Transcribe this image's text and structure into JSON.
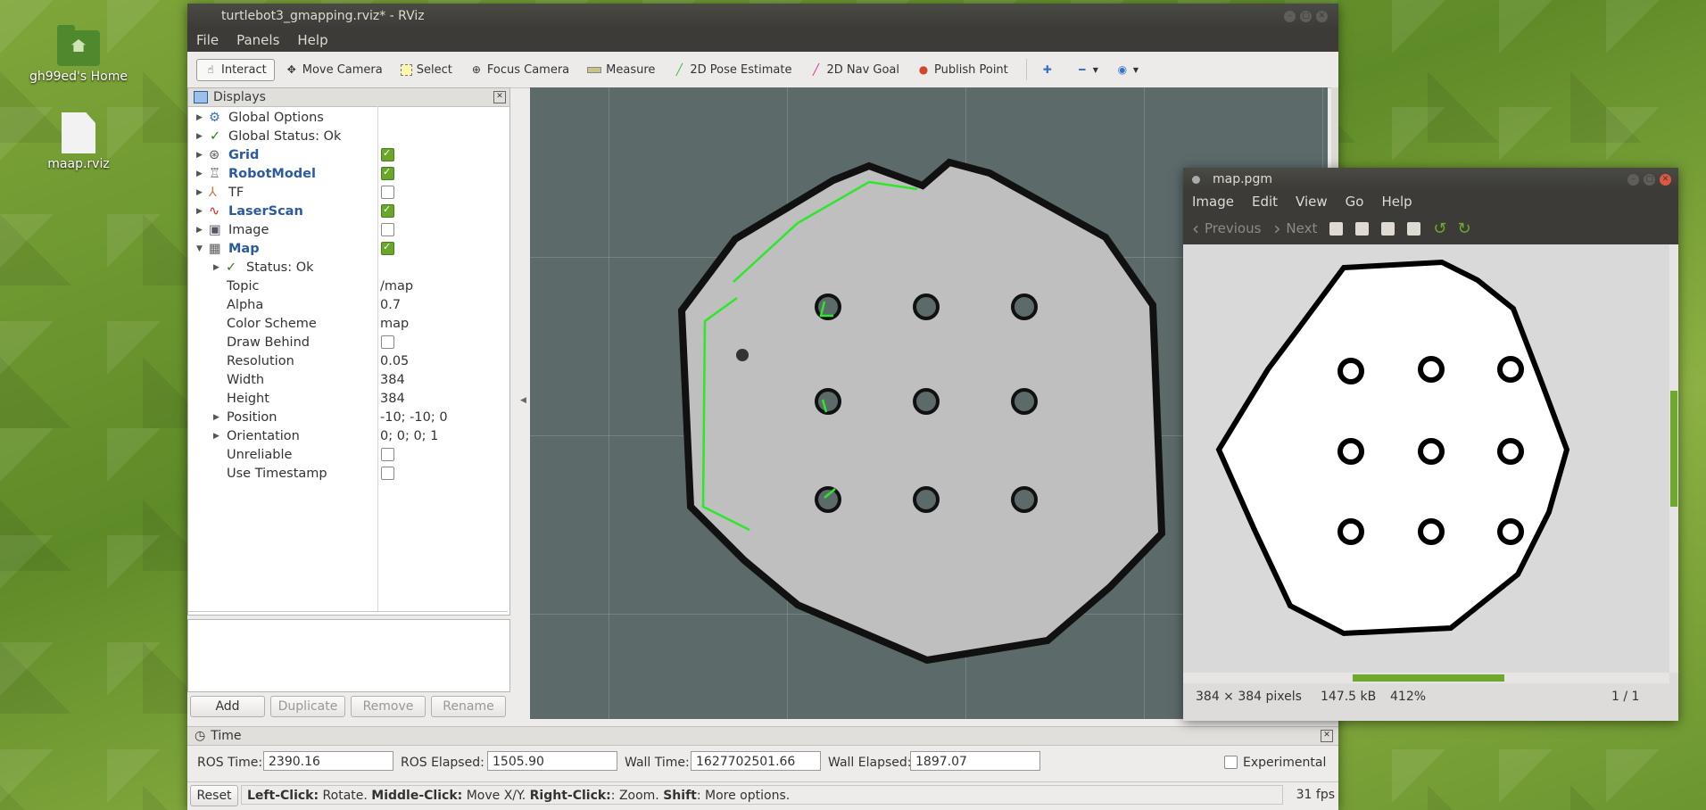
{
  "desktop": {
    "icons": [
      {
        "label": "gh99ed's Home"
      },
      {
        "label": "maap.rviz"
      }
    ]
  },
  "rviz": {
    "title": "turtlebot3_gmapping.rviz* - RViz",
    "menu": [
      "File",
      "Panels",
      "Help"
    ],
    "tools": [
      "Interact",
      "Move Camera",
      "Select",
      "Focus Camera",
      "Measure",
      "2D Pose Estimate",
      "2D Nav Goal",
      "Publish Point"
    ],
    "displays": {
      "title": "Displays",
      "items": [
        {
          "label": "Global Options"
        },
        {
          "label": "Global Status: Ok"
        },
        {
          "label": "Grid"
        },
        {
          "label": "RobotModel"
        },
        {
          "label": "TF"
        },
        {
          "label": "LaserScan"
        },
        {
          "label": "Image"
        },
        {
          "label": "Map"
        }
      ],
      "map_props": [
        {
          "label": "Status: Ok",
          "value": ""
        },
        {
          "label": "Topic",
          "value": "/map"
        },
        {
          "label": "Alpha",
          "value": "0.7"
        },
        {
          "label": "Color Scheme",
          "value": "map"
        },
        {
          "label": "Draw Behind",
          "value": ""
        },
        {
          "label": "Resolution",
          "value": "0.05"
        },
        {
          "label": "Width",
          "value": "384"
        },
        {
          "label": "Height",
          "value": "384"
        },
        {
          "label": "Position",
          "value": "-10; -10; 0"
        },
        {
          "label": "Orientation",
          "value": "0; 0; 0; 1"
        },
        {
          "label": "Unreliable",
          "value": ""
        },
        {
          "label": "Use Timestamp",
          "value": ""
        }
      ],
      "buttons": [
        "Add",
        "Duplicate",
        "Remove",
        "Rename"
      ]
    },
    "time": {
      "title": "Time",
      "ros_time_label": "ROS Time:",
      "ros_time": "2390.16",
      "ros_elapsed_label": "ROS Elapsed:",
      "ros_elapsed": "1505.90",
      "wall_time_label": "Wall Time:",
      "wall_time": "1627702501.66",
      "wall_elapsed_label": "Wall Elapsed:",
      "wall_elapsed": "1897.07",
      "experimental": "Experimental"
    },
    "status": {
      "reset": "Reset",
      "left": "Left-Click:",
      "left_desc": " Rotate. ",
      "middle": "Middle-Click:",
      "middle_desc": " Move X/Y. ",
      "right": "Right-Click:",
      "right_desc": ": Zoom. ",
      "shift": "Shift",
      "shift_desc": ": More options.",
      "fps": "31 fps"
    }
  },
  "viewer": {
    "title": "map.pgm",
    "menu": [
      "Image",
      "Edit",
      "View",
      "Go",
      "Help"
    ],
    "previous": "Previous",
    "next": "Next",
    "dims": "384 × 384 pixels",
    "size": "147.5 kB",
    "zoom": "412%",
    "pages": "1 / 1"
  }
}
